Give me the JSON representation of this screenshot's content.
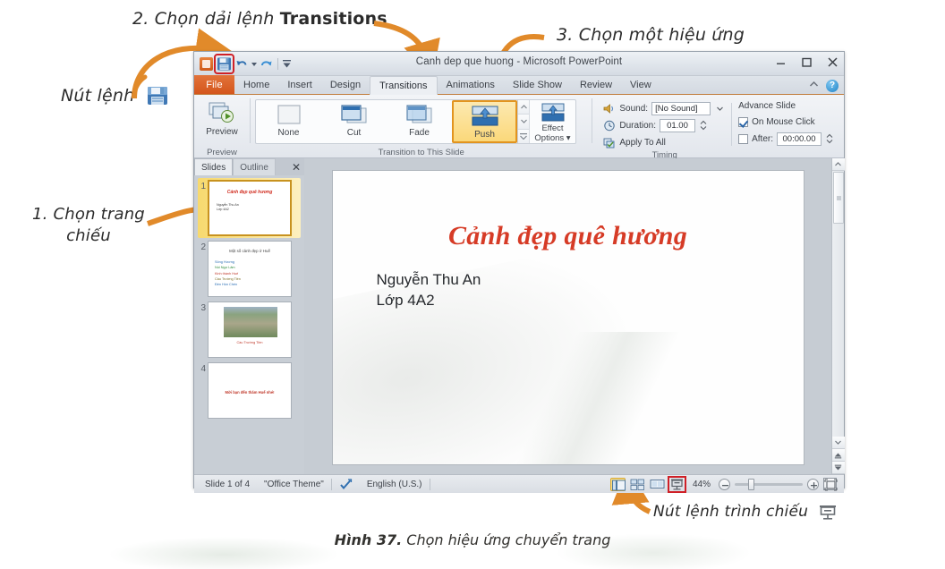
{
  "annotations": {
    "step2": "2. Chọn dải lệnh ",
    "step2_bold": "Transitions",
    "step3": "3. Chọn một hiệu ứng",
    "save_label": "Nút lệnh",
    "step1_line1": "1. Chọn trang",
    "step1_line2": "chiếu",
    "slideshow_label": "Nút lệnh trình chiếu"
  },
  "caption": {
    "figure": "Hình 37.",
    "text": " Chọn hiệu ứng chuyển trang"
  },
  "window": {
    "title": "Canh dep que huong - Microsoft PowerPoint",
    "minimize": "—",
    "maximize": "□",
    "close": "✕"
  },
  "quick_access": {
    "app_icon": "powerpoint-icon",
    "save_icon": "save-floppy-icon",
    "undo_icon": "undo-arrow-icon",
    "redo_icon": "redo-arrow-icon",
    "customize_icon": "customize-qat-icon"
  },
  "tabs": {
    "file": "File",
    "items": [
      {
        "label": "Home",
        "active": false
      },
      {
        "label": "Insert",
        "active": false
      },
      {
        "label": "Design",
        "active": false
      },
      {
        "label": "Transitions",
        "active": true
      },
      {
        "label": "Animations",
        "active": false
      },
      {
        "label": "Slide Show",
        "active": false
      },
      {
        "label": "Review",
        "active": false
      },
      {
        "label": "View",
        "active": false
      }
    ],
    "minimize_ribbon_icon": "chevron-up-icon",
    "help_icon": "?"
  },
  "ribbon": {
    "preview_group": {
      "button_label": "Preview",
      "group_label": "Preview"
    },
    "transition_group": {
      "group_label": "Transition to This Slide",
      "items": [
        {
          "label": "None",
          "selected": false
        },
        {
          "label": "Cut",
          "selected": false
        },
        {
          "label": "Fade",
          "selected": false
        },
        {
          "label": "Push",
          "selected": true
        }
      ],
      "effect_options_line1": "Effect",
      "effect_options_line2": "Options ▾"
    },
    "timing_group": {
      "group_label": "Timing",
      "sound_label": "Sound:",
      "sound_value": "[No Sound]",
      "duration_label": "Duration:",
      "duration_value": "01.00",
      "apply_to_all": "Apply To All",
      "advance_slide_label": "Advance Slide",
      "on_mouse_click": "On Mouse Click",
      "on_mouse_click_checked": true,
      "after_label": "After:",
      "after_value": "00:00.00",
      "after_checked": false
    }
  },
  "slides_pane": {
    "tab_slides": "Slides",
    "tab_outline": "Outline",
    "close_icon": "✕",
    "thumbnails": [
      {
        "number": "1",
        "selected": true,
        "title": "Cảnh đẹp quê hương",
        "sub1": "Nguyễn Thu An",
        "sub2": "Lớp 4A2"
      },
      {
        "number": "2",
        "selected": false,
        "title": "Một số cảnh đẹp ở Huế",
        "bullets": [
          {
            "text": "Sông Hương",
            "color": "#2c6fb5"
          },
          {
            "text": "Núi Ngự Lâm",
            "color": "#2e8b3d"
          },
          {
            "text": "Kinh thành Huế",
            "color": "#c0392b"
          },
          {
            "text": "Cầu Trường Tiền",
            "color": "#7a6b1f"
          },
          {
            "text": "Đền Hòn Chén",
            "color": "#2c6fb5"
          }
        ]
      },
      {
        "number": "3",
        "selected": false,
        "caption": "Cầu Trường Tiền"
      },
      {
        "number": "4",
        "selected": false,
        "text": "Mời bạn đến thăm Huế nhé!"
      }
    ]
  },
  "slide": {
    "title": "Cảnh đẹp quê hương",
    "line1": "Nguyễn Thu An",
    "line2": "Lớp 4A2"
  },
  "status_bar": {
    "slide_count": "Slide 1 of 4",
    "theme": "\"Office Theme\"",
    "spellcheck_icon": "spellcheck-icon",
    "language": "English (U.S.)",
    "views": [
      {
        "name": "normal-view",
        "active": true,
        "highlighted": false
      },
      {
        "name": "slide-sorter-view",
        "active": false,
        "highlighted": false
      },
      {
        "name": "reading-view",
        "active": false,
        "highlighted": false
      },
      {
        "name": "slide-show-view",
        "active": false,
        "highlighted": true
      }
    ],
    "zoom": "44%",
    "zoom_out_icon": "minus-icon",
    "zoom_in_icon": "plus-icon",
    "fit_window_icon": "fit-to-window-icon"
  },
  "colors": {
    "accent_orange": "#e18a2a",
    "highlight_red": "#cf2027",
    "title_red": "#d63b26",
    "file_tab": "#d4561c",
    "selected_gold": "#e2941f"
  }
}
